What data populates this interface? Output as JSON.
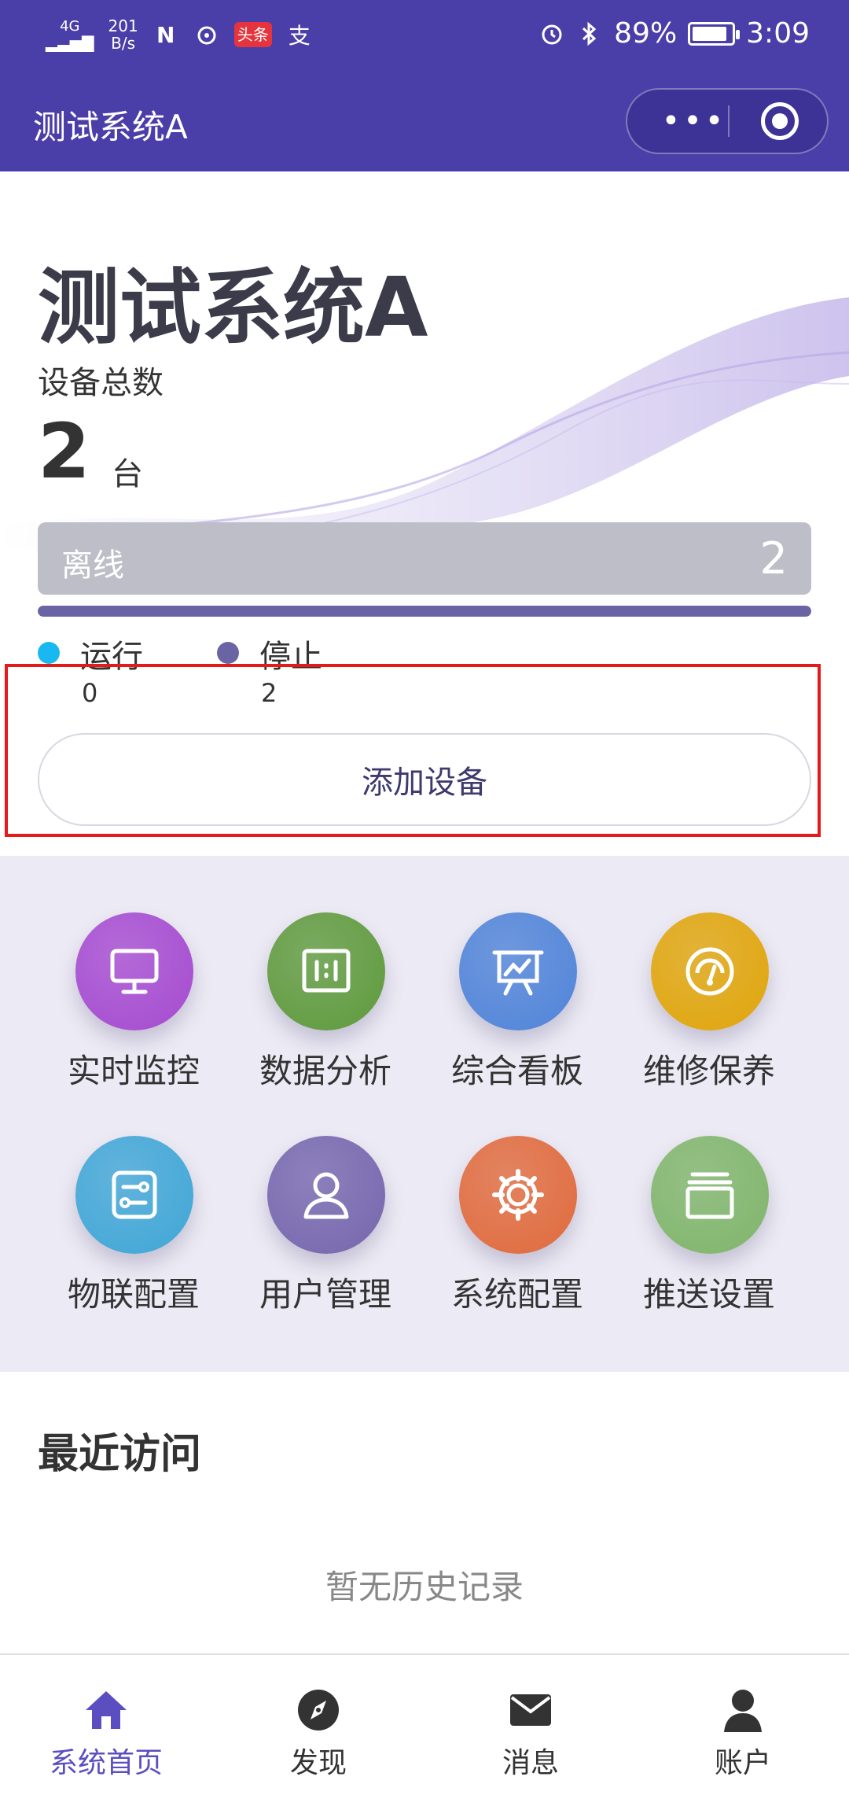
{
  "status_bar": {
    "signal": "4G",
    "net_speed_top": "201",
    "net_speed_bottom": "B/s",
    "nfc_icon": "N",
    "toutiao": "头条",
    "alipay": "支",
    "battery_percent": "89%",
    "time": "3:09",
    "battery_level": 0.89
  },
  "header": {
    "title": "测试系统A",
    "more_icon": "more-dots-icon",
    "close_icon": "target-icon"
  },
  "summary": {
    "system_name": "测试系统A",
    "total_label": "设备总数",
    "total_value": "2",
    "total_unit": "台",
    "offline_label": "离线",
    "offline_value": "2",
    "progress_fraction": 1.0,
    "legend": [
      {
        "label": "运行",
        "value": "0",
        "color": "#1ab8f0"
      },
      {
        "label": "停止",
        "value": "2",
        "color": "#6a64a4"
      }
    ],
    "add_button": "添加设备"
  },
  "functions": [
    {
      "label": "实时监控",
      "icon": "monitor-icon",
      "color": "#a54ad0"
    },
    {
      "label": "数据分析",
      "icon": "data-panel-icon",
      "color": "#5e9a3c"
    },
    {
      "label": "综合看板",
      "icon": "presentation-board-icon",
      "color": "#4f83d8"
    },
    {
      "label": "维修保养",
      "icon": "gauge-icon",
      "color": "#e0a50a"
    },
    {
      "label": "物联配置",
      "icon": "config-switch-icon",
      "color": "#3fa6d6"
    },
    {
      "label": "用户管理",
      "icon": "user-icon",
      "color": "#7566ad"
    },
    {
      "label": "系统配置",
      "icon": "gear-icon",
      "color": "#e06a3c"
    },
    {
      "label": "推送设置",
      "icon": "window-stack-icon",
      "color": "#7fb56a"
    }
  ],
  "recent": {
    "title": "最近访问",
    "empty_text": "暂无历史记录"
  },
  "tabbar": {
    "items": [
      {
        "label": "系统首页",
        "icon": "home-icon",
        "active": true
      },
      {
        "label": "发现",
        "icon": "compass-icon",
        "active": false
      },
      {
        "label": "消息",
        "icon": "mail-icon",
        "active": false
      },
      {
        "label": "账户",
        "icon": "person-icon",
        "active": false
      }
    ],
    "active_color": "#5b4ec0"
  }
}
